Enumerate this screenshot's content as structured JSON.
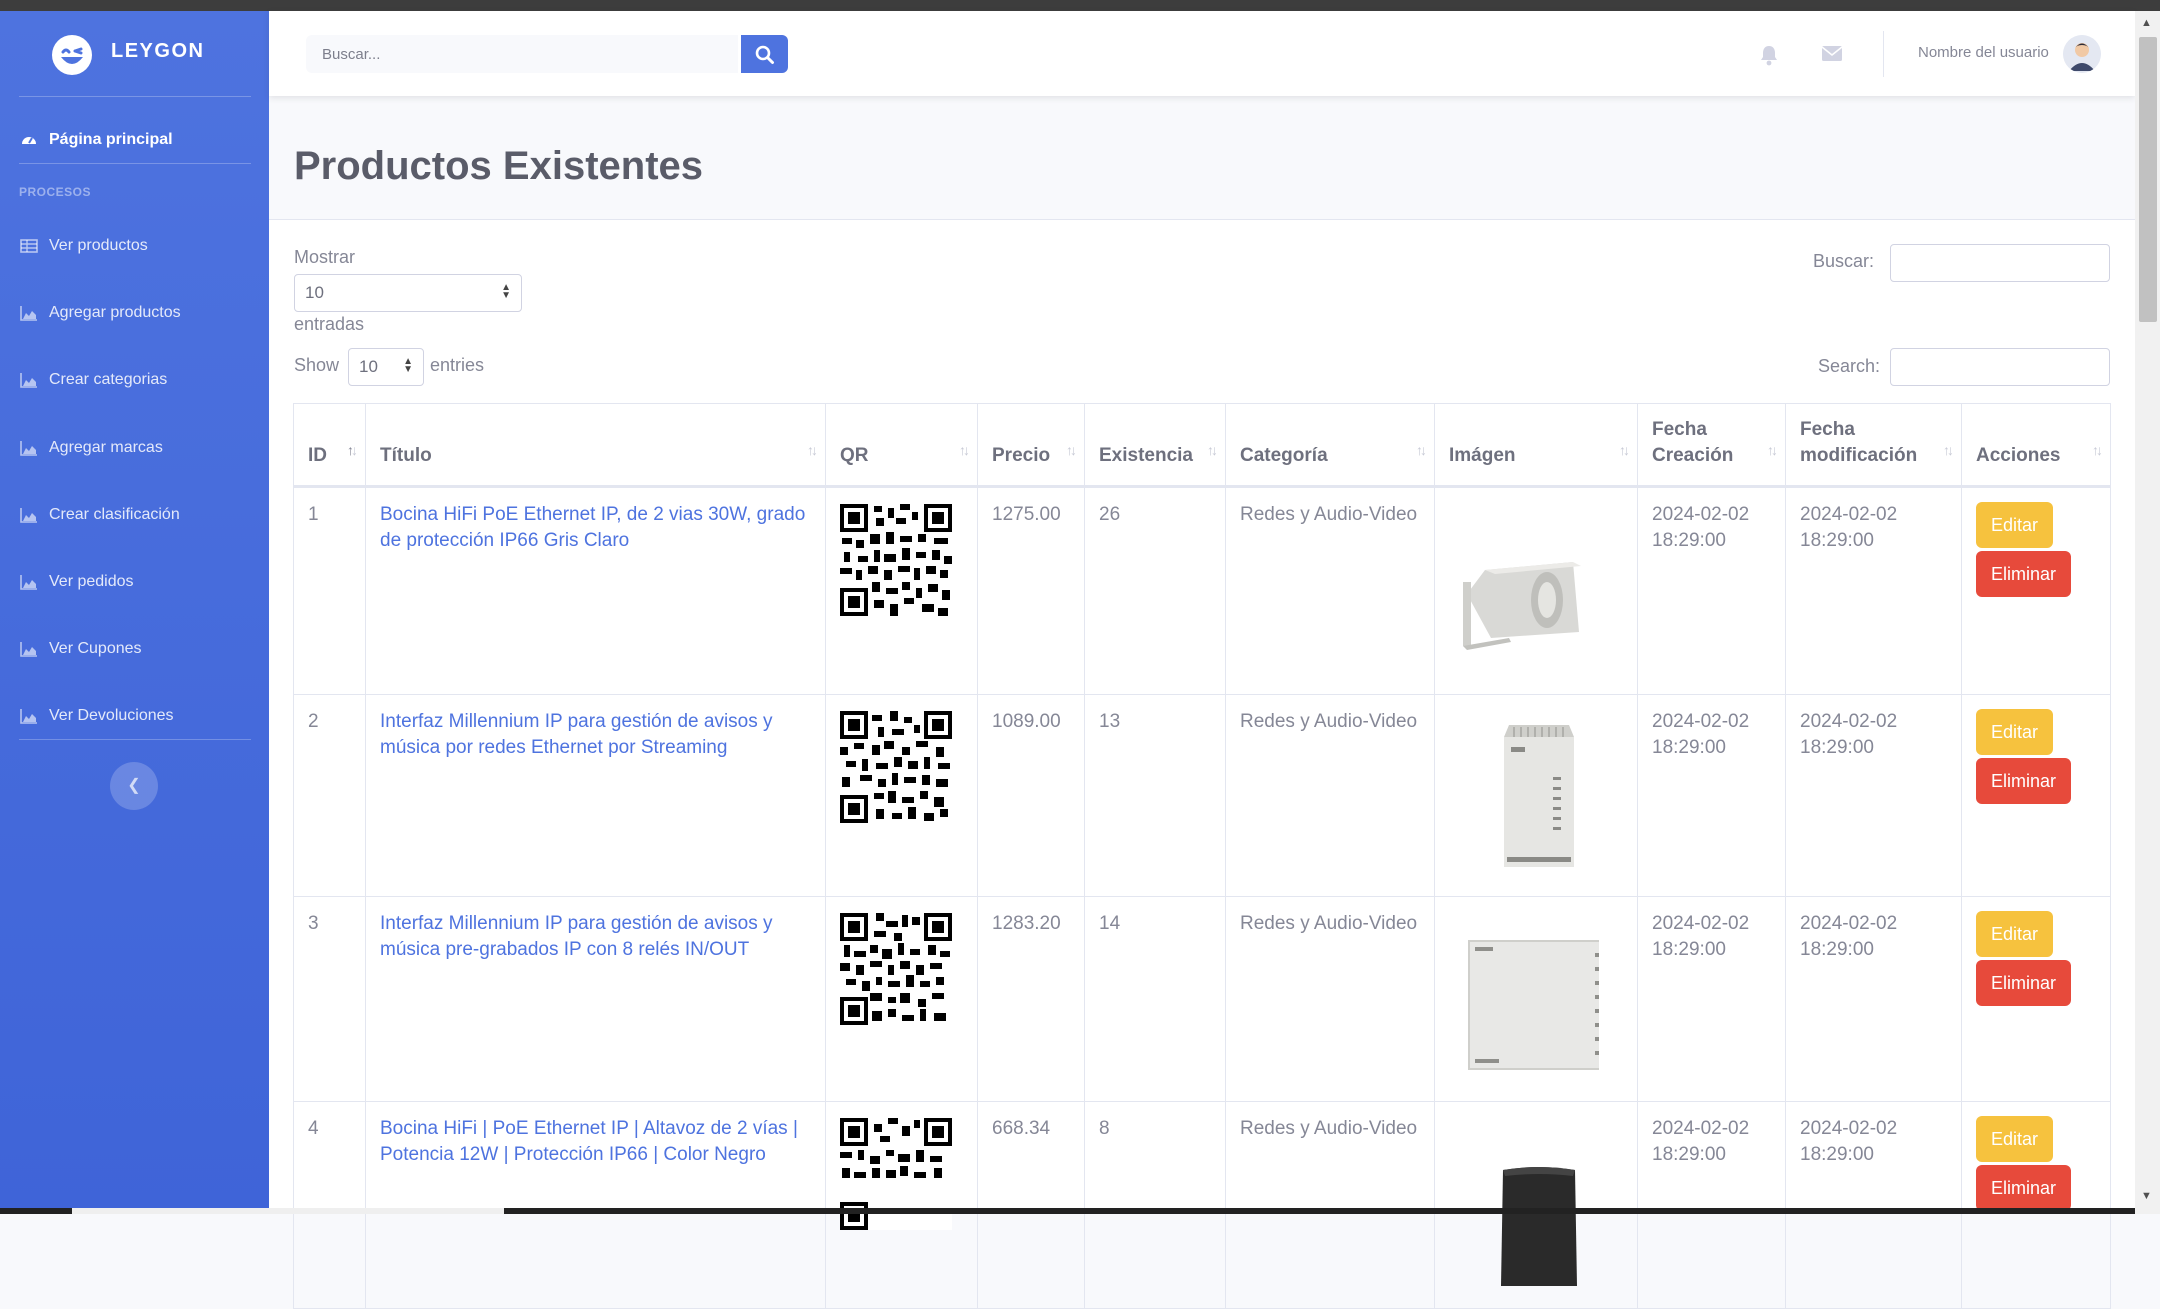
{
  "brand": {
    "name": "LEYGON"
  },
  "sidebar": {
    "dashboard_label": "Página principal",
    "heading": "PROCESOS",
    "items": [
      {
        "label": "Ver productos",
        "icon": "table-icon"
      },
      {
        "label": "Agregar productos",
        "icon": "chart-area-icon"
      },
      {
        "label": "Crear categorias",
        "icon": "chart-area-icon"
      },
      {
        "label": "Agregar marcas",
        "icon": "chart-area-icon"
      },
      {
        "label": "Crear clasificación",
        "icon": "chart-area-icon"
      },
      {
        "label": "Ver pedidos",
        "icon": "chart-area-icon"
      },
      {
        "label": "Ver Cupones",
        "icon": "chart-area-icon"
      },
      {
        "label": "Ver Devoluciones",
        "icon": "chart-area-icon"
      }
    ],
    "toggle_icon": "chevron-left-icon"
  },
  "topbar": {
    "search_placeholder": "Buscar...",
    "username": "Nombre del usuario"
  },
  "page": {
    "title": "Productos Existentes",
    "show_label_es": "Mostrar",
    "show_value_es": "10",
    "entries_label_es": "entradas",
    "search_label_es": "Buscar:",
    "show_label_en": "Show",
    "show_value_en": "10",
    "entries_label_en": "entries",
    "search_label_en": "Search:"
  },
  "table": {
    "columns": [
      "ID",
      "Título",
      "QR",
      "Precio",
      "Existencia",
      "Categoría",
      "Imágen",
      "Fecha Creación",
      "Fecha modificación",
      "Acciones"
    ],
    "rows": [
      {
        "id": "1",
        "title": "Bocina HiFi PoE Ethernet IP, de 2 vias 30W, grado de protección IP66 Gris Claro",
        "price": "1275.00",
        "stock": "26",
        "category": "Redes y Audio-Video",
        "created": "2024-02-02 18:29:00",
        "modified": "2024-02-02 18:29:00",
        "image": "horn-speaker"
      },
      {
        "id": "2",
        "title": "Interfaz Millennium IP para gestión de avisos y música por redes Ethernet por Streaming",
        "price": "1089.00",
        "stock": "13",
        "category": "Redes y Audio-Video",
        "created": "2024-02-02 18:29:00",
        "modified": "2024-02-02 18:29:00",
        "image": "rack-module"
      },
      {
        "id": "3",
        "title": "Interfaz Millennium IP para gestión de avisos y música pre-grabados IP con 8 relés IN/OUT",
        "price": "1283.20",
        "stock": "14",
        "category": "Redes y Audio-Video",
        "created": "2024-02-02 18:29:00",
        "modified": "2024-02-02 18:29:00",
        "image": "wall-interface"
      },
      {
        "id": "4",
        "title": "Bocina HiFi | PoE Ethernet IP | Altavoz de 2 vías | Potencia 12W | Protección IP66 | Color Negro",
        "price": "668.34",
        "stock": "8",
        "category": "Redes y Audio-Video",
        "created": "2024-02-02 18:29:00",
        "modified": "2024-02-02 18:29:00",
        "image": "black-speaker"
      }
    ],
    "edit_label": "Editar",
    "delete_label": "Eliminar"
  },
  "colors": {
    "primary": "#4e73df",
    "warning": "#f6c23e",
    "danger": "#e74a3b"
  }
}
